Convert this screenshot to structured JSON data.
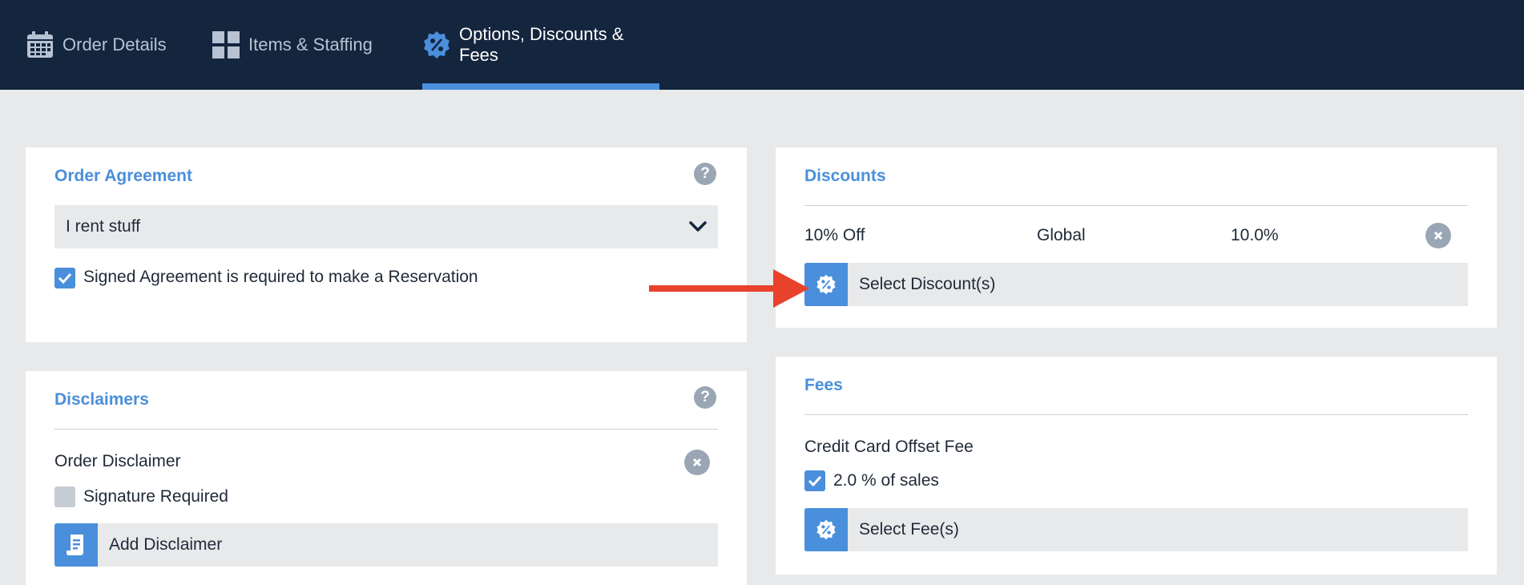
{
  "tabs": [
    {
      "label": "Order Details",
      "icon": "calendar-icon",
      "active": false
    },
    {
      "label": "Items & Staffing",
      "icon": "grid-icon",
      "active": false
    },
    {
      "label": "Options, Discounts & Fees",
      "icon": "percent-badge-icon",
      "active": true
    }
  ],
  "order_agreement": {
    "title": "Order Agreement",
    "help": "?",
    "selected_agreement": "I rent stuff",
    "signed_required_label": "Signed Agreement is required to make a Reservation",
    "signed_required_checked": true
  },
  "disclaimers": {
    "title": "Disclaimers",
    "help": "?",
    "item_name": "Order Disclaimer",
    "signature_label": "Signature Required",
    "signature_checked": false,
    "add_label": "Add Disclaimer"
  },
  "discounts": {
    "title": "Discounts",
    "row": {
      "name": "10% Off",
      "scope": "Global",
      "amount": "10.0%"
    },
    "select_label": "Select Discount(s)"
  },
  "fees": {
    "title": "Fees",
    "fee_name": "Credit Card Offset Fee",
    "fee_option_label": "2.0 % of sales",
    "fee_option_checked": true,
    "select_label": "Select Fee(s)"
  },
  "colors": {
    "nav_bg": "#14253e",
    "accent": "#4a8fdb",
    "page_bg": "#e8e9eb",
    "annotation_arrow": "#e8412c"
  }
}
